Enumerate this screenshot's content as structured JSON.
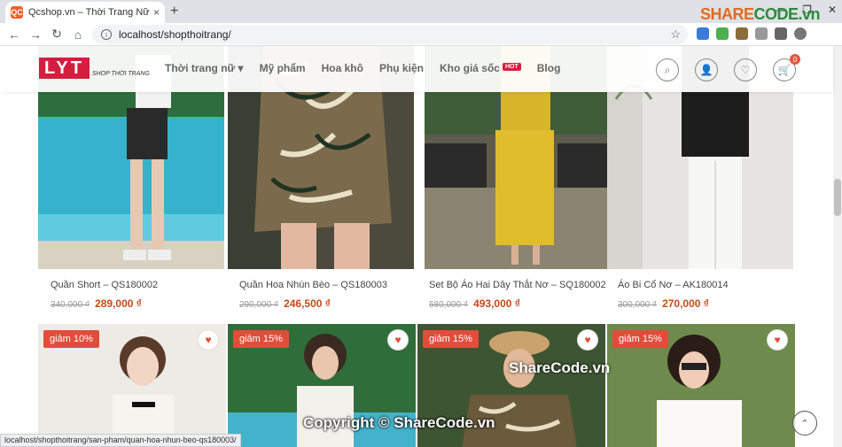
{
  "browser": {
    "tab_title": "Qcshop.vn – Thời Trang Nữ Cao C",
    "favicon": "QC",
    "url": "localhost/shopthoitrang/",
    "status_url": "localhost/shopthoitrang/san-pham/quan-hoa-nhun-beo-qs180003/"
  },
  "watermark": {
    "brand_a": "SHARE",
    "brand_b": "CODE.vn",
    "mid": "ShareCode.vn",
    "copyright": "Copyright © ShareCode.vn"
  },
  "header": {
    "logo": "LYT",
    "logo_sub": "SHOP THỜI TRANG",
    "menu": [
      "Thời trang nữ",
      "Mỹ phẩm",
      "Hoa khô",
      "Phụ kiện",
      "Kho giá sốc",
      "Blog"
    ],
    "hot_badge": "HOT",
    "cart_count": "0"
  },
  "products": [
    {
      "name": "Quần Short – QS180002",
      "old_price": "340,000 ₫",
      "new_price": "289,000 ₫"
    },
    {
      "name": "Quần Hoa Nhún Bèo – QS180003",
      "old_price": "290,000 ₫",
      "new_price": "246,500 ₫"
    },
    {
      "name": "Set Bộ Áo Hai Dây Thắt Nơ – SQ180002",
      "old_price": "580,000 ₫",
      "new_price": "493,000 ₫"
    },
    {
      "name": "Áo Bi Cổ Nơ – AK180014",
      "old_price": "300,000 ₫",
      "new_price": "270,000 ₫"
    }
  ],
  "row2": [
    {
      "sale": "giảm 10%"
    },
    {
      "sale": "giảm 15%"
    },
    {
      "sale": "giảm 15%"
    },
    {
      "sale": "giảm 15%"
    }
  ],
  "colors": {
    "accent": "#d51e3f",
    "price": "#c44a1c",
    "sale": "#e14d3a"
  }
}
